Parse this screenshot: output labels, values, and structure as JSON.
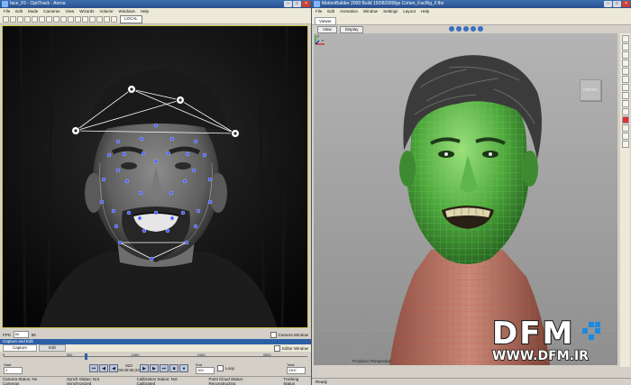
{
  "left_window": {
    "title": "face_F5 - OptiTrack - Arena",
    "menu": [
      "File",
      "Edit",
      "Mode",
      "Cameras",
      "View",
      "Wizards",
      "Volume",
      "Windows",
      "Help"
    ],
    "coord_select": "LOCAL",
    "fps_label": "FPS",
    "fps_value": "60",
    "fps_extra": "56",
    "camera_window_label": "Camera Window",
    "capture_header": "Capture and Edit",
    "capture_tab": "Capture",
    "edit_tab": "Edit",
    "editor_window_label": "Editor Window",
    "timeline_ticks": [
      "0",
      "500",
      "1000",
      "1500",
      "2000"
    ],
    "timeline_value": 623,
    "timeline_max": 2307,
    "start_field": "1",
    "start_label": "Start",
    "frame_number": "623",
    "timecode": "00:00:06:23",
    "end_label": "End",
    "end_field": "100",
    "loop_label": "Loop",
    "total_label": "Total",
    "total_field": "2307",
    "status": {
      "camera": "Camera Status: No Cameras",
      "synch": "Synch Status: Not Synchronized",
      "calibration": "Calibration Status: Not Calibrated",
      "point_cloud": "Point Cloud Status: Reconstructing",
      "tracking": "Tracking Status"
    }
  },
  "right_window": {
    "title": "MotionBuilder 2009   Build 15/08/2008gs   Cohen_FacRig_F.fbx",
    "menu": [
      "File",
      "Edit",
      "Animation",
      "Window",
      "Settings",
      "Layout",
      "Help"
    ],
    "viewer_tab": "Viewer",
    "view_button": "View",
    "display_button": "Display",
    "front_label": "FRONT",
    "producer_label": "Producer Perspective",
    "status": "Ready",
    "axis_x": "x",
    "axis_y": "y"
  },
  "watermark": {
    "brand": "DFM",
    "url": "WWW.DFM.IR"
  },
  "colors": {
    "title_blue": "#2d5fa6",
    "marker_blue": "#3a4cff",
    "wire_green": "#4fd24a",
    "logo_blue": "#1a8be0"
  }
}
